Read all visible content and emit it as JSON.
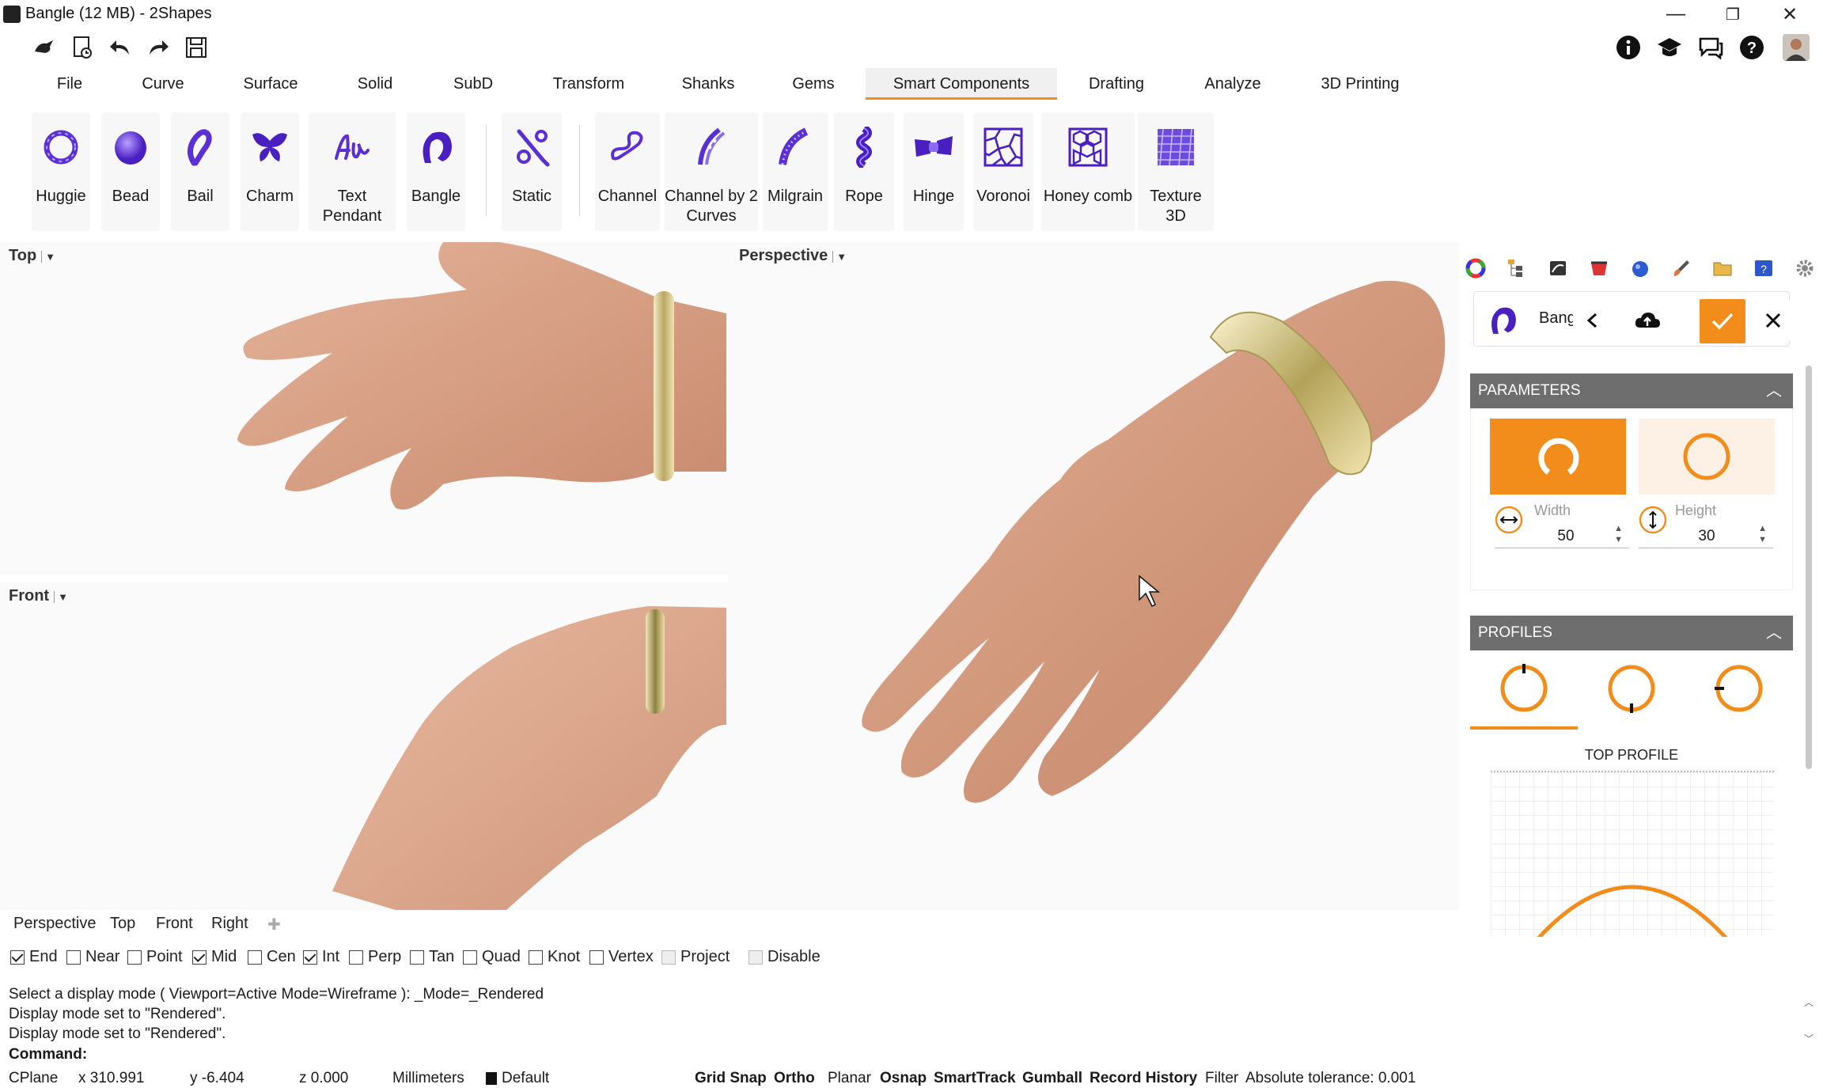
{
  "window": {
    "title": "Bangle (12 MB) - 2Shapes",
    "minimize": "—",
    "restore": "❐",
    "close": "✕"
  },
  "menu_tabs": [
    "File",
    "Curve",
    "Surface",
    "Solid",
    "SubD",
    "Transform",
    "Shanks",
    "Gems",
    "Smart Components",
    "Drafting",
    "Analyze",
    "3D Printing"
  ],
  "active_tab": "Smart Components",
  "ribbon": {
    "tools": [
      {
        "label": "Huggie",
        "icon": "huggie-icon"
      },
      {
        "label": "Bead",
        "icon": "bead-icon"
      },
      {
        "label": "Bail",
        "icon": "bail-icon"
      },
      {
        "label": "Charm",
        "icon": "charm-butterfly-icon"
      },
      {
        "label": "Text Pendant",
        "icon": "text-pendant-icon"
      },
      {
        "label": "Bangle",
        "icon": "bangle-icon"
      },
      {
        "label": "Static",
        "icon": "static-icon"
      },
      {
        "label": "Channel",
        "icon": "channel-icon"
      },
      {
        "label": "Channel by 2 Curves",
        "icon": "channel-by-2-curves-icon"
      },
      {
        "label": "Milgrain",
        "icon": "milgrain-icon"
      },
      {
        "label": "Rope",
        "icon": "rope-icon"
      },
      {
        "label": "Hinge",
        "icon": "hinge-icon"
      },
      {
        "label": "Voronoi",
        "icon": "voronoi-icon"
      },
      {
        "label": "Honey comb",
        "icon": "honeycomb-icon"
      },
      {
        "label": "Texture 3D",
        "icon": "texture-3d-icon"
      }
    ]
  },
  "viewports": {
    "top": "Top",
    "front": "Front",
    "perspective": "Perspective"
  },
  "panel": {
    "component_name": "Bangl",
    "parameters": {
      "header": "PARAMETERS",
      "width_label": "Width",
      "width_value": "50",
      "height_label": "Height",
      "height_value": "30"
    },
    "profiles": {
      "header": "PROFILES",
      "top_profile": "TOP PROFILE"
    }
  },
  "viewport_tabs": [
    "Perspective",
    "Top",
    "Front",
    "Right"
  ],
  "osnaps": [
    {
      "label": "End",
      "checked": true
    },
    {
      "label": "Near",
      "checked": false
    },
    {
      "label": "Point",
      "checked": false
    },
    {
      "label": "Mid",
      "checked": true
    },
    {
      "label": "Cen",
      "checked": false
    },
    {
      "label": "Int",
      "checked": true
    },
    {
      "label": "Perp",
      "checked": false
    },
    {
      "label": "Tan",
      "checked": false
    },
    {
      "label": "Quad",
      "checked": false
    },
    {
      "label": "Knot",
      "checked": false
    },
    {
      "label": "Vertex",
      "checked": false
    },
    {
      "label": "Project",
      "checked": false,
      "disabled": true
    },
    {
      "label": "Disable",
      "checked": false,
      "disabled": true
    }
  ],
  "command": {
    "line1": "Select a display mode ( Viewport=Active  Mode=Wireframe ): _Mode=_Rendered",
    "line2": "Display mode set to \"Rendered\".",
    "line3": "Display mode set to \"Rendered\".",
    "prompt": "Command:"
  },
  "status": {
    "cplane": "CPlane",
    "x": "x 310.991",
    "y": "y -6.404",
    "z": "z 0.000",
    "units": "Millimeters",
    "layer": "Default",
    "grid_snap": "Grid Snap",
    "ortho": "Ortho",
    "planar": "Planar",
    "osnap": "Osnap",
    "smarttrack": "SmartTrack",
    "gumball": "Gumball",
    "record_history": "Record History",
    "filter": "Filter",
    "tolerance": "Absolute tolerance: 0.001"
  },
  "colors": {
    "accent": "#f28c1a",
    "icon_purple": "#5b2fd6",
    "gold": "#d8c98a",
    "skin": "#d9a083",
    "panel_header": "#6e6e6e"
  }
}
